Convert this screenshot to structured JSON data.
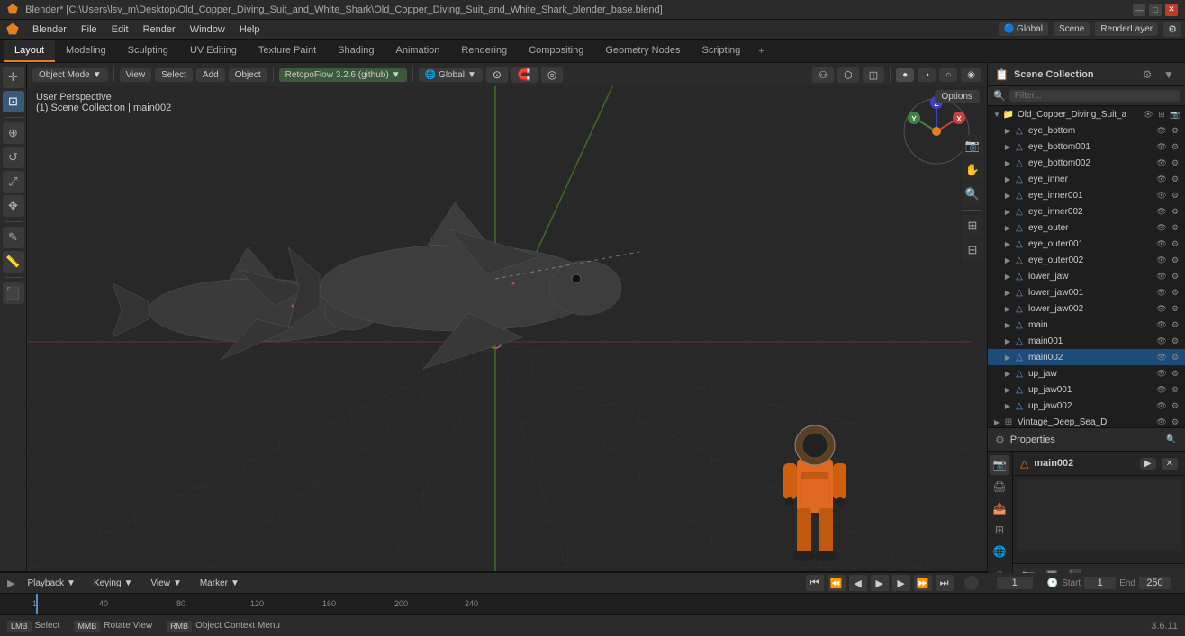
{
  "app": {
    "title": "Blender* [C:\\Users\\lsv_m\\Desktop\\Old_Copper_Diving_Suit_and_White_Shark\\Old_Copper_Diving_Suit_and_White_Shark_blender_base.blend]",
    "version": "3.6.11"
  },
  "menubar": {
    "items": [
      "Blender",
      "File",
      "Edit",
      "Render",
      "Window",
      "Help"
    ]
  },
  "workspace_tabs": {
    "items": [
      "Layout",
      "Modeling",
      "Sculpting",
      "UV Editing",
      "Texture Paint",
      "Shading",
      "Animation",
      "Rendering",
      "Compositing",
      "Geometry Nodes",
      "Scripting"
    ],
    "active": "Layout",
    "plus_label": "+"
  },
  "viewport": {
    "mode": "Object Mode",
    "view": "User Perspective",
    "scene_info": "(1) Scene Collection | main002",
    "add_on": "RetopoFlow 3.2.6 (github)",
    "transform": "Global",
    "options_label": "Options",
    "nav_widget": "gizmo"
  },
  "viewport_header": {
    "mode_btn": "Object Mode",
    "view_btn": "View",
    "select_btn": "Select",
    "add_btn": "Add",
    "object_btn": "Object",
    "retopoflow_btn": "RetopoFlow 3.2.6 (github)",
    "transform_btn": "Global",
    "snap_btn": "snap",
    "proportional_btn": "proportional",
    "overlay_btn": "overlay",
    "shading_btn": "shading"
  },
  "outliner": {
    "title": "Scene Collection",
    "search_placeholder": "Filter...",
    "items": [
      {
        "name": "Old_Copper_Diving_Suit_a",
        "level": 0,
        "icon": "collection",
        "expanded": true,
        "visible": true
      },
      {
        "name": "eye_bottom",
        "level": 1,
        "icon": "mesh",
        "expanded": false,
        "visible": true
      },
      {
        "name": "eye_bottom001",
        "level": 1,
        "icon": "mesh",
        "expanded": false,
        "visible": true
      },
      {
        "name": "eye_bottom002",
        "level": 1,
        "icon": "mesh",
        "expanded": false,
        "visible": true
      },
      {
        "name": "eye_inner",
        "level": 1,
        "icon": "mesh",
        "expanded": false,
        "visible": true
      },
      {
        "name": "eye_inner001",
        "level": 1,
        "icon": "mesh",
        "expanded": false,
        "visible": true
      },
      {
        "name": "eye_inner002",
        "level": 1,
        "icon": "mesh",
        "expanded": false,
        "visible": true
      },
      {
        "name": "eye_outer",
        "level": 1,
        "icon": "mesh",
        "expanded": false,
        "visible": true
      },
      {
        "name": "eye_outer001",
        "level": 1,
        "icon": "mesh",
        "expanded": false,
        "visible": true
      },
      {
        "name": "eye_outer002",
        "level": 1,
        "icon": "mesh",
        "expanded": false,
        "visible": true
      },
      {
        "name": "lower_jaw",
        "level": 1,
        "icon": "mesh",
        "expanded": false,
        "visible": true
      },
      {
        "name": "lower_jaw001",
        "level": 1,
        "icon": "mesh",
        "expanded": false,
        "visible": true
      },
      {
        "name": "lower_jaw002",
        "level": 1,
        "icon": "mesh",
        "expanded": false,
        "visible": true
      },
      {
        "name": "main",
        "level": 1,
        "icon": "mesh",
        "expanded": false,
        "visible": true
      },
      {
        "name": "main001",
        "level": 1,
        "icon": "mesh",
        "expanded": false,
        "visible": true
      },
      {
        "name": "main002",
        "level": 1,
        "icon": "mesh",
        "expanded": false,
        "visible": true,
        "selected": true
      },
      {
        "name": "up_jaw",
        "level": 1,
        "icon": "mesh",
        "expanded": false,
        "visible": true
      },
      {
        "name": "up_jaw001",
        "level": 1,
        "icon": "mesh",
        "expanded": false,
        "visible": true
      },
      {
        "name": "up_jaw002",
        "level": 1,
        "icon": "mesh",
        "expanded": false,
        "visible": true
      },
      {
        "name": "Vintage_Deep_Sea_Di",
        "level": 0,
        "icon": "collection",
        "expanded": false,
        "visible": true
      }
    ]
  },
  "properties": {
    "selected_label": "main002",
    "icons": [
      "scene",
      "render",
      "output",
      "view_layer",
      "scene_data",
      "world",
      "object",
      "modifier",
      "particles",
      "physics",
      "constraints",
      "data",
      "material",
      "shading"
    ]
  },
  "timeline": {
    "playback_label": "Playback",
    "keying_label": "Keying",
    "view_label": "View",
    "marker_label": "Marker",
    "current_frame": "1",
    "start_label": "Start",
    "start_value": "1",
    "end_label": "End",
    "end_value": "250",
    "frame_numbers": [
      "1",
      "40",
      "80",
      "120",
      "160",
      "200",
      "240"
    ],
    "frame_marks": [
      1,
      40,
      80,
      120,
      160,
      200,
      240
    ]
  },
  "statusbar": {
    "select_label": "Select",
    "select_key": "Left Mouse",
    "rotate_label": "Rotate View",
    "rotate_key": "Middle Mouse",
    "context_label": "Object Context Menu",
    "context_key": "Right Mouse",
    "version": "3.6.11"
  },
  "left_toolbar": {
    "tools": [
      "cursor",
      "move",
      "rotate",
      "scale",
      "transform",
      "annotate",
      "measure",
      "add"
    ]
  },
  "colors": {
    "accent": "#e08020",
    "active_blue": "#4a90d9",
    "selected_highlight": "#1d4b7a",
    "viewport_bg": "#282828",
    "grid_color": "rgba(255,255,255,0.07)"
  }
}
